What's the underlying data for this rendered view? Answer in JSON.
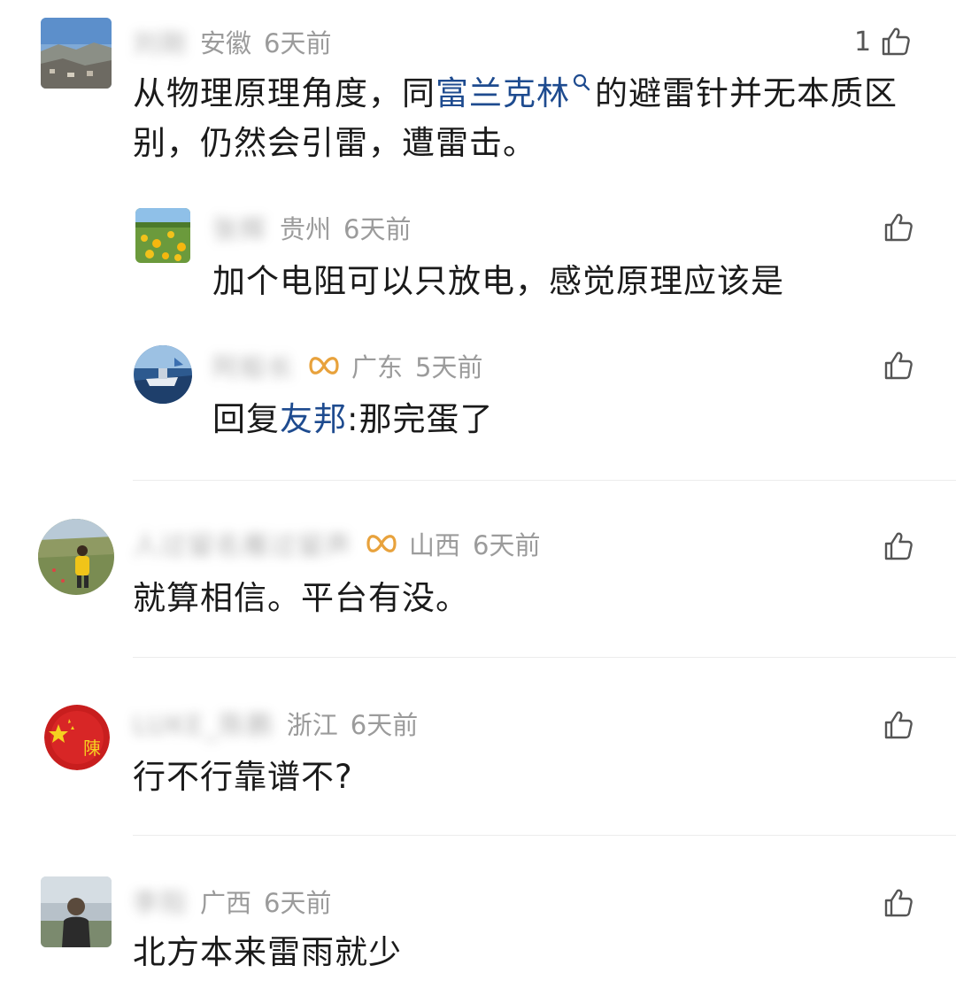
{
  "comments": [
    {
      "username": "刘刚",
      "region": "安徽",
      "time": "6天前",
      "like_count": "1",
      "content_before": "从物理原理角度，同",
      "content_link": "富兰克林",
      "content_after": "的避雷针并无本质区别，仍然会引雷，遭雷击。",
      "icons": {
        "like": "thumbs-up-icon",
        "search": "search-icon"
      }
    },
    {
      "username": "张辉",
      "region": "贵州",
      "time": "6天前",
      "content": "加个电阻可以只放电，感觉原理应该是"
    },
    {
      "username": "阿船长",
      "region": "广东",
      "time": "5天前",
      "content_prefix": "回复",
      "content_mention": "友邦",
      "content_after": ":那完蛋了",
      "icons": {
        "badge": "vip-ribbon-icon"
      }
    },
    {
      "username": "人过留名雁过留声",
      "region": "山西",
      "time": "6天前",
      "content": "就算相信。平台有没。",
      "icons": {
        "badge": "vip-ribbon-icon"
      }
    },
    {
      "username": "LUKE_陈鹏",
      "region": "浙江",
      "time": "6天前",
      "content": "行不行靠谱不?"
    },
    {
      "username": "李阳",
      "region": "广西",
      "time": "6天前",
      "content": "北方本来雷雨就少"
    }
  ],
  "colors": {
    "link": "#1e4b8f",
    "badge": "#e8a23c",
    "meta": "#9b9b9b",
    "text": "#1a1a1a"
  }
}
